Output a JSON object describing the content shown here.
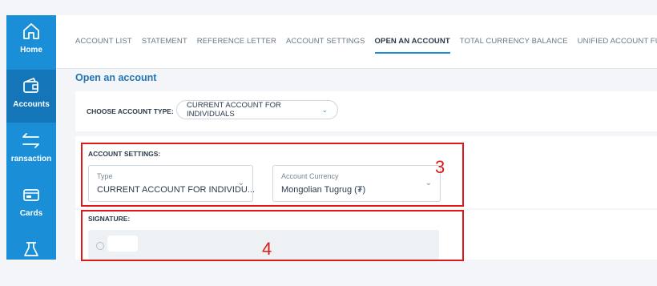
{
  "sidebar": {
    "items": [
      {
        "label": "Home",
        "icon": "home-icon",
        "active": false
      },
      {
        "label": "Accounts",
        "icon": "wallet-icon",
        "active": true
      },
      {
        "label": "ransaction",
        "icon": "transfer-arrows-icon",
        "active": false
      },
      {
        "label": "Cards",
        "icon": "card-icon",
        "active": false
      },
      {
        "label": "",
        "icon": "loan-icon",
        "active": false
      }
    ]
  },
  "tabs": [
    {
      "label": "ACCOUNT LIST"
    },
    {
      "label": "STATEMENT"
    },
    {
      "label": "REFERENCE LETTER"
    },
    {
      "label": "ACCOUNT SETTINGS"
    },
    {
      "label": "OPEN AN ACCOUNT",
      "active": true
    },
    {
      "label": "TOTAL CURRENCY BALANCE"
    },
    {
      "label": "UNIFIED ACCOUNT FUND"
    }
  ],
  "page": {
    "title": "Open an account"
  },
  "choose": {
    "label": "CHOOSE ACCOUNT TYPE:",
    "value": "CURRENT ACCOUNT FOR INDIVIDUALS"
  },
  "settings": {
    "heading": "ACCOUNT SETTINGS:",
    "type": {
      "label": "Type",
      "value": "CURRENT ACCOUNT FOR INDIVIDU..."
    },
    "currency": {
      "label": "Account Currency",
      "value": "Mongolian Tugrug (₮)"
    }
  },
  "signature": {
    "heading": "SIGNATURE:"
  },
  "annotations": {
    "box3": "3",
    "box4": "4"
  },
  "colors": {
    "accent": "#1a8fd8",
    "annotation": "#e01818"
  }
}
